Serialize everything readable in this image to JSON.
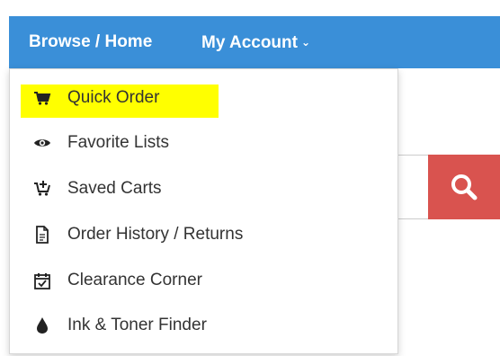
{
  "nav": {
    "browse_label": "Browse / Home",
    "account_label": "My Account",
    "bar_color": "#3a8fd8"
  },
  "dropdown": {
    "items": [
      {
        "label": "Quick Order",
        "icon": "cart-icon",
        "highlighted": true
      },
      {
        "label": "Favorite Lists",
        "icon": "eye-icon"
      },
      {
        "label": "Saved Carts",
        "icon": "cart-plus-icon"
      },
      {
        "label": "Order History / Returns",
        "icon": "document-icon"
      },
      {
        "label": "Clearance Corner",
        "icon": "calendar-check-icon"
      },
      {
        "label": "Ink & Toner Finder",
        "icon": "ink-drop-icon"
      }
    ],
    "highlight_color": "#ffff00"
  },
  "search": {
    "button_icon": "search-icon",
    "button_color": "#d9534f"
  }
}
